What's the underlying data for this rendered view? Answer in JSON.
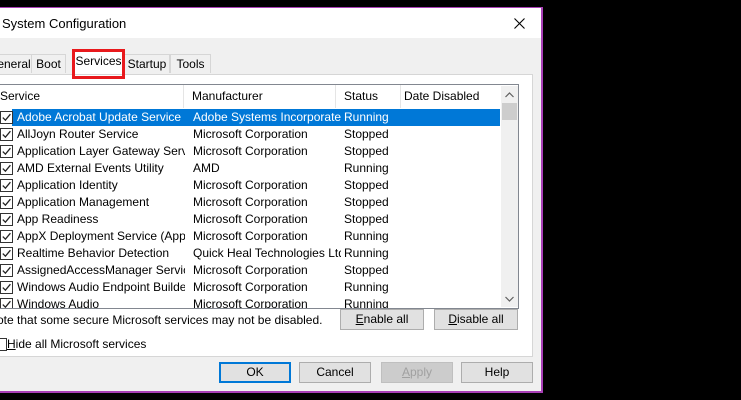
{
  "window": {
    "title": "System Configuration",
    "accent_color": "#a83fb6",
    "close_icon": "close-icon"
  },
  "tabs": [
    {
      "label": "eneral",
      "active": false
    },
    {
      "label": "Boot",
      "active": false
    },
    {
      "label": "Services",
      "active": true
    },
    {
      "label": "Startup",
      "active": false
    },
    {
      "label": "Tools",
      "active": false
    }
  ],
  "highlight_color": "#e8191c",
  "columns": {
    "service": "Service",
    "manufacturer": "Manufacturer",
    "status": "Status",
    "date_disabled": "Date Disabled"
  },
  "services": [
    {
      "name": "Adobe Acrobat Update Service",
      "manufacturer": "Adobe Systems Incorporated",
      "status": "Running",
      "date_disabled": "",
      "checked": true,
      "selected": true
    },
    {
      "name": "AllJoyn Router Service",
      "manufacturer": "Microsoft Corporation",
      "status": "Stopped",
      "date_disabled": "",
      "checked": true
    },
    {
      "name": "Application Layer Gateway Service",
      "manufacturer": "Microsoft Corporation",
      "status": "Stopped",
      "date_disabled": "",
      "checked": true
    },
    {
      "name": "AMD External Events Utility",
      "manufacturer": "AMD",
      "status": "Running",
      "date_disabled": "",
      "checked": true
    },
    {
      "name": "Application Identity",
      "manufacturer": "Microsoft Corporation",
      "status": "Stopped",
      "date_disabled": "",
      "checked": true
    },
    {
      "name": "Application Management",
      "manufacturer": "Microsoft Corporation",
      "status": "Stopped",
      "date_disabled": "",
      "checked": true
    },
    {
      "name": "App Readiness",
      "manufacturer": "Microsoft Corporation",
      "status": "Stopped",
      "date_disabled": "",
      "checked": true
    },
    {
      "name": "AppX Deployment Service (AppX...",
      "manufacturer": "Microsoft Corporation",
      "status": "Running",
      "date_disabled": "",
      "checked": true
    },
    {
      "name": "Realtime Behavior Detection",
      "manufacturer": "Quick Heal Technologies Ltd.",
      "status": "Running",
      "date_disabled": "",
      "checked": true
    },
    {
      "name": "AssignedAccessManager Service",
      "manufacturer": "Microsoft Corporation",
      "status": "Stopped",
      "date_disabled": "",
      "checked": true
    },
    {
      "name": "Windows Audio Endpoint Builder",
      "manufacturer": "Microsoft Corporation",
      "status": "Running",
      "date_disabled": "",
      "checked": true
    },
    {
      "name": "Windows Audio",
      "manufacturer": "Microsoft Corporation",
      "status": "Running",
      "date_disabled": "",
      "checked": true
    }
  ],
  "note": "ote that some secure Microsoft services may not be disabled.",
  "enable_all": {
    "u": "E",
    "rest": "nable all"
  },
  "disable_all": {
    "u": "D",
    "rest": "isable all"
  },
  "hide_ms": {
    "u": "H",
    "rest": "ide all Microsoft services",
    "checked": false
  },
  "buttons": {
    "ok": "OK",
    "cancel": "Cancel",
    "apply": {
      "u": "A",
      "rest": "pply"
    },
    "help": "Help"
  }
}
